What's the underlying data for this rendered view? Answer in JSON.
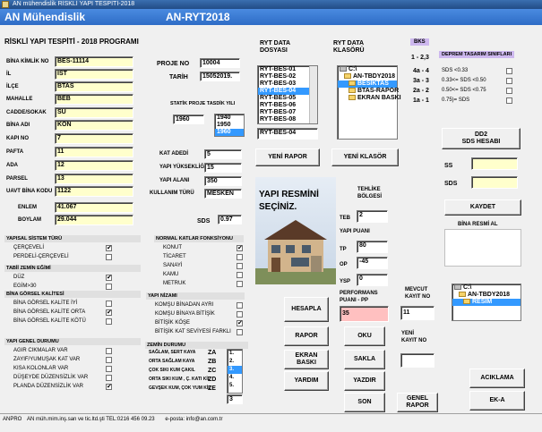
{
  "window": {
    "title": "AN mühendislik  RİSKLİ YAPI TESPİTİ-2018"
  },
  "banner": {
    "company": "AN Mühendislik",
    "product": "AN-RYT2018"
  },
  "heading": "RİSKLİ YAPI TESPİTİ - 2018  PROGRAMI",
  "left_fields": [
    {
      "label": "BİNA KİMLİK NO",
      "value": "BES-11114"
    },
    {
      "label": "İL",
      "value": "IST"
    },
    {
      "label": "İLÇE",
      "value": "BTAS"
    },
    {
      "label": "MAHALLE",
      "value": "BEB"
    },
    {
      "label": "CADDE/SOKAK",
      "value": "SU"
    },
    {
      "label": "BİNA ADI",
      "value": "KON"
    },
    {
      "label": "KAPI NO",
      "value": "7"
    },
    {
      "label": "PAFTA",
      "value": "11"
    },
    {
      "label": "ADA",
      "value": "12"
    },
    {
      "label": "PARSEL",
      "value": "13"
    },
    {
      "label": "UAVT BİNA KODU",
      "value": "1122"
    },
    {
      "label": "ENLEM",
      "value": "41.067"
    },
    {
      "label": "BOYLAM",
      "value": "29.044"
    }
  ],
  "proje": {
    "no_label": "PROJE NO",
    "no_value": "10004",
    "tarih_label": "TARİH",
    "tarih_value": "15052019."
  },
  "statik": {
    "label": "STATİK PROJE TASDİK YILI",
    "value": "1960",
    "options": [
      "1940",
      "1950",
      "1960"
    ],
    "selected": 2
  },
  "mid_fields": [
    {
      "label": "KAT ADEDİ",
      "value": "5"
    },
    {
      "label": "YAPI  YÜKSEKLİĞİ",
      "value": "15"
    },
    {
      "label": "YAPI ALANI",
      "value": "350"
    },
    {
      "label": "KULLANIM TÜRÜ",
      "value": "MESKEN"
    }
  ],
  "sds": {
    "label": "SDS",
    "value": "0.97"
  },
  "ryt_data": {
    "title_line1": "RYT  DATA",
    "title_line2": "DOSYASI",
    "items": [
      "RYT-BES-01",
      "RYT-BES-02",
      "RYT-BES-03",
      "RYT-BES-04",
      "RYT-BES-05",
      "RYT-BES-06",
      "RYT-BES-07",
      "RYT-BES-08"
    ],
    "selected": 3,
    "current": "RYT-BES-04"
  },
  "ryt_folder": {
    "title_line1": "RYT  DATA",
    "title_line2": "KLASÖRÜ",
    "items": [
      "C:\\",
      "AN-TBDY2018",
      "BESİKTAS",
      "BTAS-RAPOR",
      "EKRAN BASKI"
    ],
    "selected": 2
  },
  "bks": {
    "label": "BKS",
    "range": "1 - 2,3",
    "deprem_title": "DEPREM TASARIM SINIFLARI",
    "rows": [
      {
        "cls": "4a - 4",
        "cond": "SDS <0.33"
      },
      {
        "cls": "3a - 3",
        "cond": "0.33<= SDS <0.50"
      },
      {
        "cls": "2a - 2",
        "cond": "0.50<= SDS <0.75"
      },
      {
        "cls": "1a - 1",
        "cond": "0.75)= SDS"
      }
    ]
  },
  "buttons": {
    "yeni_rapor": "YENİ RAPOR",
    "yeni_klasor": "YENİ KLASÖR",
    "dd2_line1": "DD2",
    "dd2_line2": "SDS HESABI",
    "kaydet": "KAYDET",
    "hesapla": "HESAPLA",
    "rapor": "RAPOR",
    "oku": "OKU",
    "ekran_line1": "EKRAN",
    "ekran_line2": "BASKI",
    "sakla": "SAKLA",
    "yardim": "YARDIM",
    "yazdir": "YAZDIR",
    "son": "SON",
    "genel_line1": "GENEL",
    "genel_line2": "RAPOR",
    "aciklama": "ACIKLAMA",
    "eka": "EK-A"
  },
  "ss": {
    "ss_label": "SS",
    "sds_label": "SDS",
    "ss_value": "",
    "sds_value": ""
  },
  "bina_resmi_label": "BİNA RESMİ  AL",
  "bina_folder": {
    "items": [
      "C:\\",
      "AN-TBDY2018",
      "RESIM"
    ],
    "selected": 2
  },
  "yapi_resmi": {
    "line1": "YAPI RESMİNİ",
    "line2": "SEÇİNİZ."
  },
  "tehlike": {
    "title_line1": "TEHLİKE",
    "title_line2": "BÖLGESİ",
    "teb_label": "TEB",
    "teb_value": "2",
    "puan_label": "YAPI   PUANI",
    "tp_label": "TP",
    "tp_value": "80",
    "op_label": "OP",
    "op_value": "-45",
    "ysp_label": "YSP",
    "ysp_value": "0",
    "perf_line1": "PERFORMANS",
    "perf_line2": "PUANI - PP",
    "pp_value": "35"
  },
  "mevcut": {
    "line1": "MEVCUT",
    "line2": "KAYIT NO",
    "value": "11",
    "yeni_line1": "YENİ",
    "yeni_line2": "KAYIT NO",
    "yeni_value": ""
  },
  "sistem": {
    "title": "YAPISAL  SİSTEM  TÜRÜ",
    "items": [
      {
        "label": "ÇERÇEVELİ",
        "on": true
      },
      {
        "label": "PERDELİ-ÇERÇEVELİ",
        "on": false
      }
    ]
  },
  "zemin_egimi": {
    "title": "TABİİ ZEMİN EĞİMİ",
    "items": [
      {
        "label": "DÜZ",
        "on": true
      },
      {
        "label": "EGİM>30",
        "on": false
      }
    ]
  },
  "gorsel": {
    "title": "BİNA GÖRSEL KALİTESİ",
    "items": [
      {
        "label": "BİNA GÖRSEL KALİTE İYİ",
        "on": false
      },
      {
        "label": "BİNA GÖRSEL KALİTE ORTA",
        "on": true
      },
      {
        "label": "BİNA GÖRSEL KALİTE KÖTÜ",
        "on": false
      }
    ]
  },
  "genel_durum": {
    "title": "YAPI GENEL DURUMU",
    "items": [
      {
        "label": "AGIR CIKMALAR  VAR",
        "on": false
      },
      {
        "label": "ZAYIF/YUMUŞAK KAT VAR",
        "on": false
      },
      {
        "label": "KISA KOLONLAR VAR",
        "on": false
      },
      {
        "label": "DÜŞEYDE DÜZENSİZLİK VAR",
        "on": false
      },
      {
        "label": "PLANDA DÜZENSİZLİK VAR",
        "on": true
      }
    ]
  },
  "normal_kat": {
    "title": "NORMAL KATLAR FONKSİYONU",
    "items": [
      {
        "label": "KONUT",
        "on": true
      },
      {
        "label": "TİCARET",
        "on": false
      },
      {
        "label": "SANAYİ",
        "on": false
      },
      {
        "label": "KAMU",
        "on": false
      },
      {
        "label": "METRUK",
        "on": false
      }
    ]
  },
  "nizam": {
    "title": "YAPI NİZAMI",
    "items": [
      {
        "label": "KOMŞU BİNADAN AYRI",
        "on": false
      },
      {
        "label": "KOMŞU BİNAYA BİTİŞİK",
        "on": false
      },
      {
        "label": "BİTİŞİK KÖŞE",
        "on": true
      },
      {
        "label": "BİTİŞİK KAT SEVİYESİ FARKLI",
        "on": false
      }
    ]
  },
  "zemin_durumu": {
    "title": "ZEMİN DURUMU",
    "items": [
      {
        "label": "SAĞLAM,  SERT KAYA",
        "code": "ZA"
      },
      {
        "label": "ORTA SAĞLAM KAYA",
        "code": "ZB"
      },
      {
        "label": "ÇOK SIKI KUM ÇAKIL",
        "code": "ZC"
      },
      {
        "label": "ORTA SIKI KUM , Ç. KATI KİL",
        "code": "ZD"
      },
      {
        "label": "GEVŞEK KUM, ÇOK YUM KİL",
        "code": "ZE"
      }
    ],
    "list": [
      "1.",
      "2.",
      "3.",
      "4.",
      "5."
    ],
    "selected": 2,
    "value": "3"
  },
  "status": {
    "company": "ANPRO",
    "text": "AN müh.mim.inş.san ve tic.ltd.şti  TEL:0216 456 09.23",
    "email": "e-posta:  info@an.com.tr"
  }
}
